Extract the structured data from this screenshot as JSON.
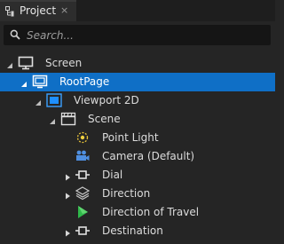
{
  "tab": {
    "title": "Project",
    "close": "×"
  },
  "search": {
    "placeholder": "Search..."
  },
  "tree": [
    {
      "label": "Screen",
      "icon": "monitor-icon",
      "expanded": true
    },
    {
      "label": "RootPage",
      "icon": "page-icon",
      "expanded": true,
      "selected": true
    },
    {
      "label": "Viewport 2D",
      "icon": "viewport-icon",
      "expanded": true
    },
    {
      "label": "Scene",
      "icon": "scene-icon",
      "expanded": true
    },
    {
      "label": "Point Light",
      "icon": "point-light-icon",
      "expanded": null
    },
    {
      "label": "Camera (Default)",
      "icon": "camera-icon",
      "expanded": null
    },
    {
      "label": "Dial",
      "icon": "component-node-icon",
      "expanded": false
    },
    {
      "label": "Direction",
      "icon": "layers-icon",
      "expanded": false
    },
    {
      "label": "Direction of Travel",
      "icon": "cone-icon",
      "expanded": null
    },
    {
      "label": "Destination",
      "icon": "component-node-icon",
      "expanded": false
    }
  ],
  "colors": {
    "selection": "#0f6fc6",
    "accent": "#1e90ff",
    "panel": "#252525"
  }
}
